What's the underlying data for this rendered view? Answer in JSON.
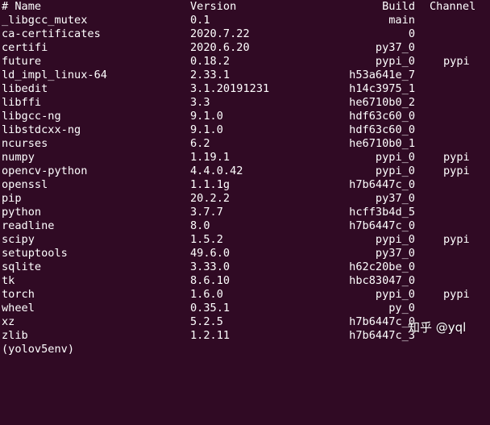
{
  "terminal": {
    "header": {
      "name": "# Name",
      "version": "Version",
      "build": "Build",
      "channel": "Channel"
    },
    "packages": [
      {
        "name": "_libgcc_mutex",
        "version": "0.1",
        "build": "main",
        "channel": ""
      },
      {
        "name": "ca-certificates",
        "version": "2020.7.22",
        "build": "0",
        "channel": ""
      },
      {
        "name": "certifi",
        "version": "2020.6.20",
        "build": "py37_0",
        "channel": ""
      },
      {
        "name": "future",
        "version": "0.18.2",
        "build": "pypi_0",
        "channel": "pypi"
      },
      {
        "name": "ld_impl_linux-64",
        "version": "2.33.1",
        "build": "h53a641e_7",
        "channel": ""
      },
      {
        "name": "libedit",
        "version": "3.1.20191231",
        "build": "h14c3975_1",
        "channel": ""
      },
      {
        "name": "libffi",
        "version": "3.3",
        "build": "he6710b0_2",
        "channel": ""
      },
      {
        "name": "libgcc-ng",
        "version": "9.1.0",
        "build": "hdf63c60_0",
        "channel": ""
      },
      {
        "name": "libstdcxx-ng",
        "version": "9.1.0",
        "build": "hdf63c60_0",
        "channel": ""
      },
      {
        "name": "ncurses",
        "version": "6.2",
        "build": "he6710b0_1",
        "channel": ""
      },
      {
        "name": "numpy",
        "version": "1.19.1",
        "build": "pypi_0",
        "channel": "pypi"
      },
      {
        "name": "opencv-python",
        "version": "4.4.0.42",
        "build": "pypi_0",
        "channel": "pypi"
      },
      {
        "name": "openssl",
        "version": "1.1.1g",
        "build": "h7b6447c_0",
        "channel": ""
      },
      {
        "name": "pip",
        "version": "20.2.2",
        "build": "py37_0",
        "channel": ""
      },
      {
        "name": "python",
        "version": "3.7.7",
        "build": "hcff3b4d_5",
        "channel": ""
      },
      {
        "name": "readline",
        "version": "8.0",
        "build": "h7b6447c_0",
        "channel": ""
      },
      {
        "name": "scipy",
        "version": "1.5.2",
        "build": "pypi_0",
        "channel": "pypi"
      },
      {
        "name": "setuptools",
        "version": "49.6.0",
        "build": "py37_0",
        "channel": ""
      },
      {
        "name": "sqlite",
        "version": "3.33.0",
        "build": "h62c20be_0",
        "channel": ""
      },
      {
        "name": "tk",
        "version": "8.6.10",
        "build": "hbc83047_0",
        "channel": ""
      },
      {
        "name": "torch",
        "version": "1.6.0",
        "build": "pypi_0",
        "channel": "pypi"
      },
      {
        "name": "wheel",
        "version": "0.35.1",
        "build": "py_0",
        "channel": ""
      },
      {
        "name": "xz",
        "version": "5.2.5",
        "build": "h7b6447c_0",
        "channel": ""
      },
      {
        "name": "zlib",
        "version": "1.2.11",
        "build": "h7b6447c_3",
        "channel": ""
      }
    ],
    "prompt": {
      "env": "(yolov5env) ",
      "userhost": "",
      "path": "",
      "tail": ""
    }
  },
  "watermark": "知乎 @yql",
  "colors": {
    "background": "#300a24",
    "text": "#ffffff",
    "prompt_user": "#8ae234",
    "prompt_path": "#729fcf"
  }
}
